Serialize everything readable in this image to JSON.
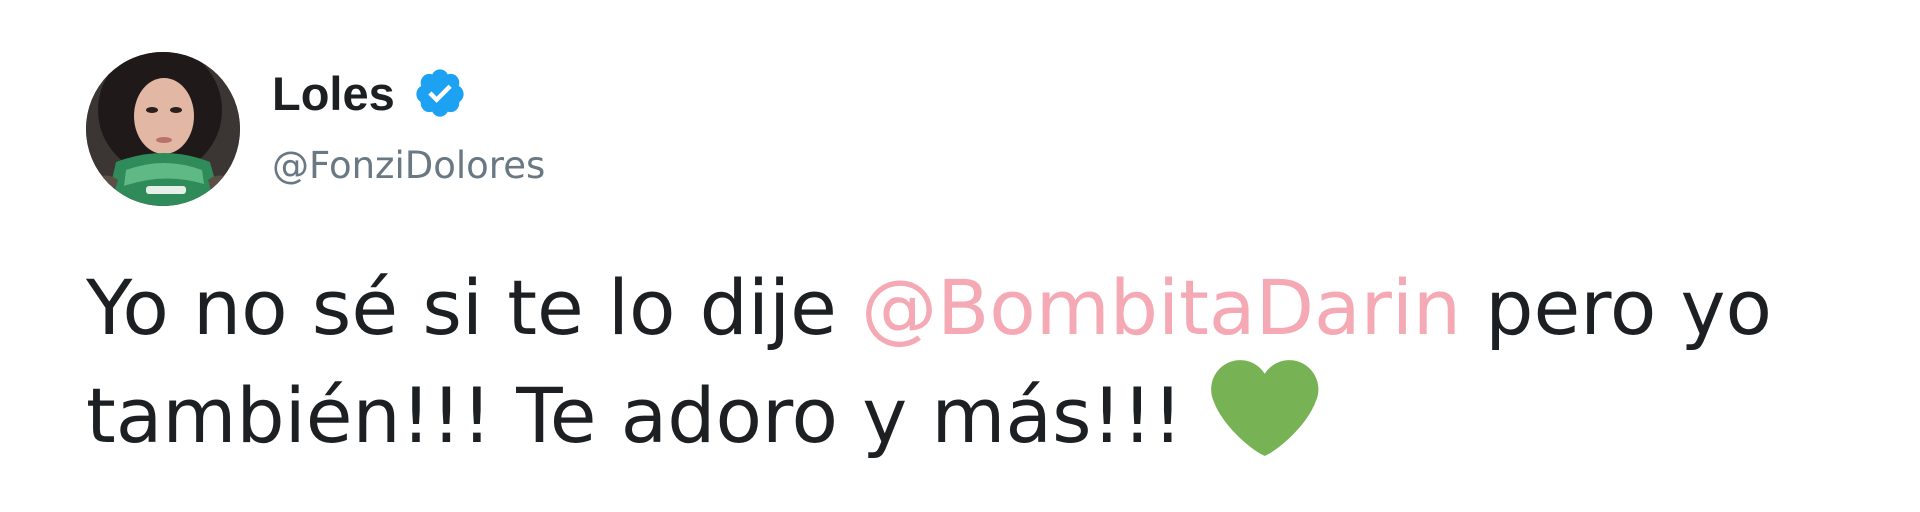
{
  "author": {
    "display_name": "Loles",
    "handle": "@FonziDolores",
    "verified_icon": "verified-badge-icon",
    "verified_color": "#1da1f2"
  },
  "tweet": {
    "line1_before": "Yo no sé si te lo dije ",
    "mention": "@BombitaDarin",
    "line1_after": " pero yo",
    "line2": "también!!! Te adoro y más!!!",
    "emoji": "green-heart-icon",
    "emoji_color": "#77b255",
    "mention_color": "#f4a9b4"
  }
}
